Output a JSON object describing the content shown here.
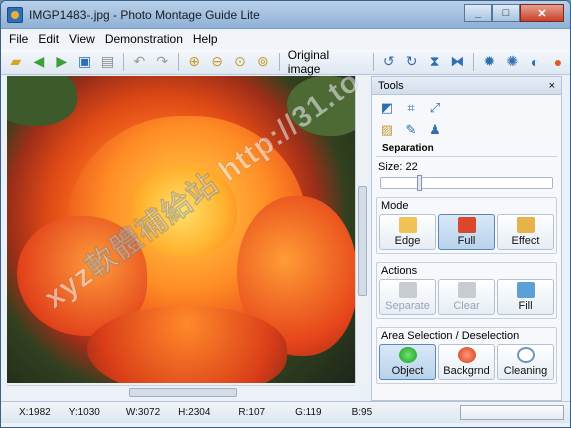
{
  "window": {
    "title": "IMGP1483-.jpg - Photo Montage Guide Lite",
    "minimize": "_",
    "maximize": "□",
    "close": "✕"
  },
  "menu": {
    "items": [
      "File",
      "Edit",
      "View",
      "Demonstration",
      "Help"
    ]
  },
  "toolbar": {
    "original_image_label": "Original image"
  },
  "tools": {
    "title": "Tools",
    "close": "×",
    "separation_label": "Separation",
    "size_label": "Size: 22",
    "size_value": 22,
    "mode": {
      "title": "Mode",
      "edge": "Edge",
      "full": "Full",
      "effect": "Effect"
    },
    "actions": {
      "title": "Actions",
      "separate": "Separate",
      "clear": "Clear",
      "fill": "Fill"
    },
    "area": {
      "title": "Area Selection / Deselection",
      "object": "Object",
      "backgrnd": "Backgrnd",
      "cleaning": "Cleaning"
    }
  },
  "status": {
    "x": "X:1982",
    "y": "Y:1030",
    "w": "W:3072",
    "h": "H:2304",
    "r": "R:107",
    "g": "G:119",
    "b": "B:95"
  },
  "watermark": "xyz軟體補給站 http://31.to"
}
